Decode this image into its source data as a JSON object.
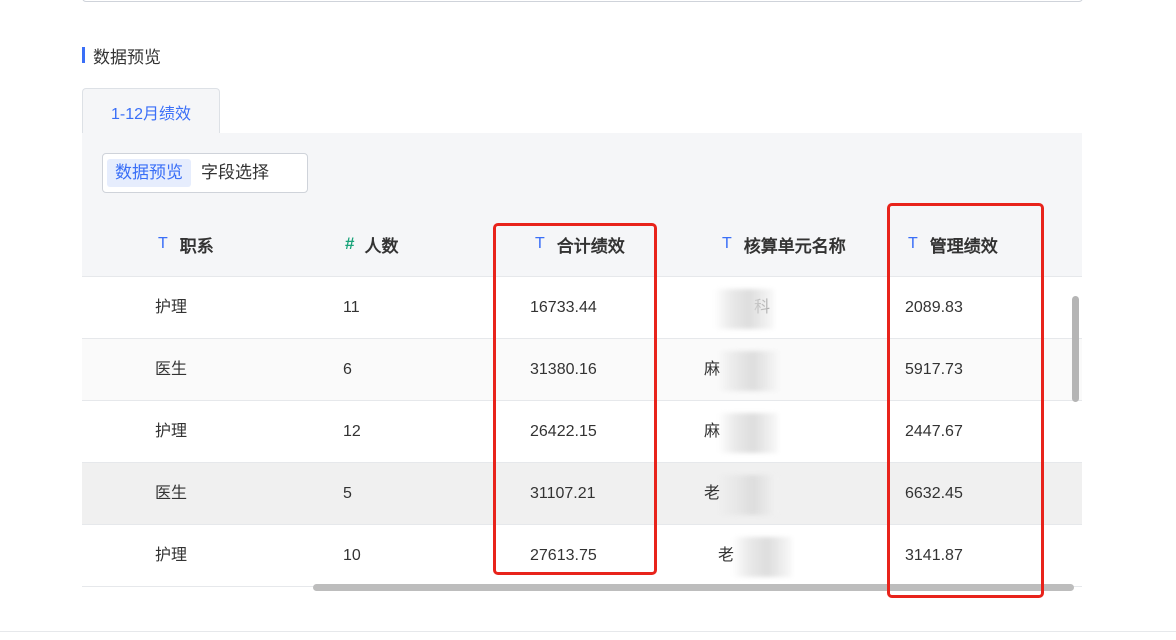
{
  "section": {
    "title": "数据预览"
  },
  "tabs": [
    {
      "label": "1-12月绩效"
    }
  ],
  "toggle": {
    "preview": "数据预览",
    "fields": "字段选择"
  },
  "columns": [
    {
      "icon": "T",
      "label": "职系"
    },
    {
      "icon": "#",
      "label": "人数"
    },
    {
      "icon": "T",
      "label": "合计绩效"
    },
    {
      "icon": "T",
      "label": "核算单元名称"
    },
    {
      "icon": "T",
      "label": "管理绩效"
    }
  ],
  "rows": [
    {
      "zhixi": "护理",
      "renshu": "11",
      "heji": "16733.44",
      "danyuan": "科",
      "guanli": "2089.83"
    },
    {
      "zhixi": "医生",
      "renshu": "6",
      "heji": "31380.16",
      "danyuan": "麻",
      "guanli": "5917.73"
    },
    {
      "zhixi": "护理",
      "renshu": "12",
      "heji": "26422.15",
      "danyuan": "麻",
      "guanli": "2447.67"
    },
    {
      "zhixi": "医生",
      "renshu": "5",
      "heji": "31107.21",
      "danyuan": "老",
      "guanli": "6632.45"
    },
    {
      "zhixi": "护理",
      "renshu": "10",
      "heji": "27613.75",
      "danyuan": "老",
      "guanli": "3141.87"
    }
  ],
  "colors": {
    "accent": "#3a6ff7",
    "number_icon": "#1aa37a",
    "highlight": "#e8231b"
  }
}
